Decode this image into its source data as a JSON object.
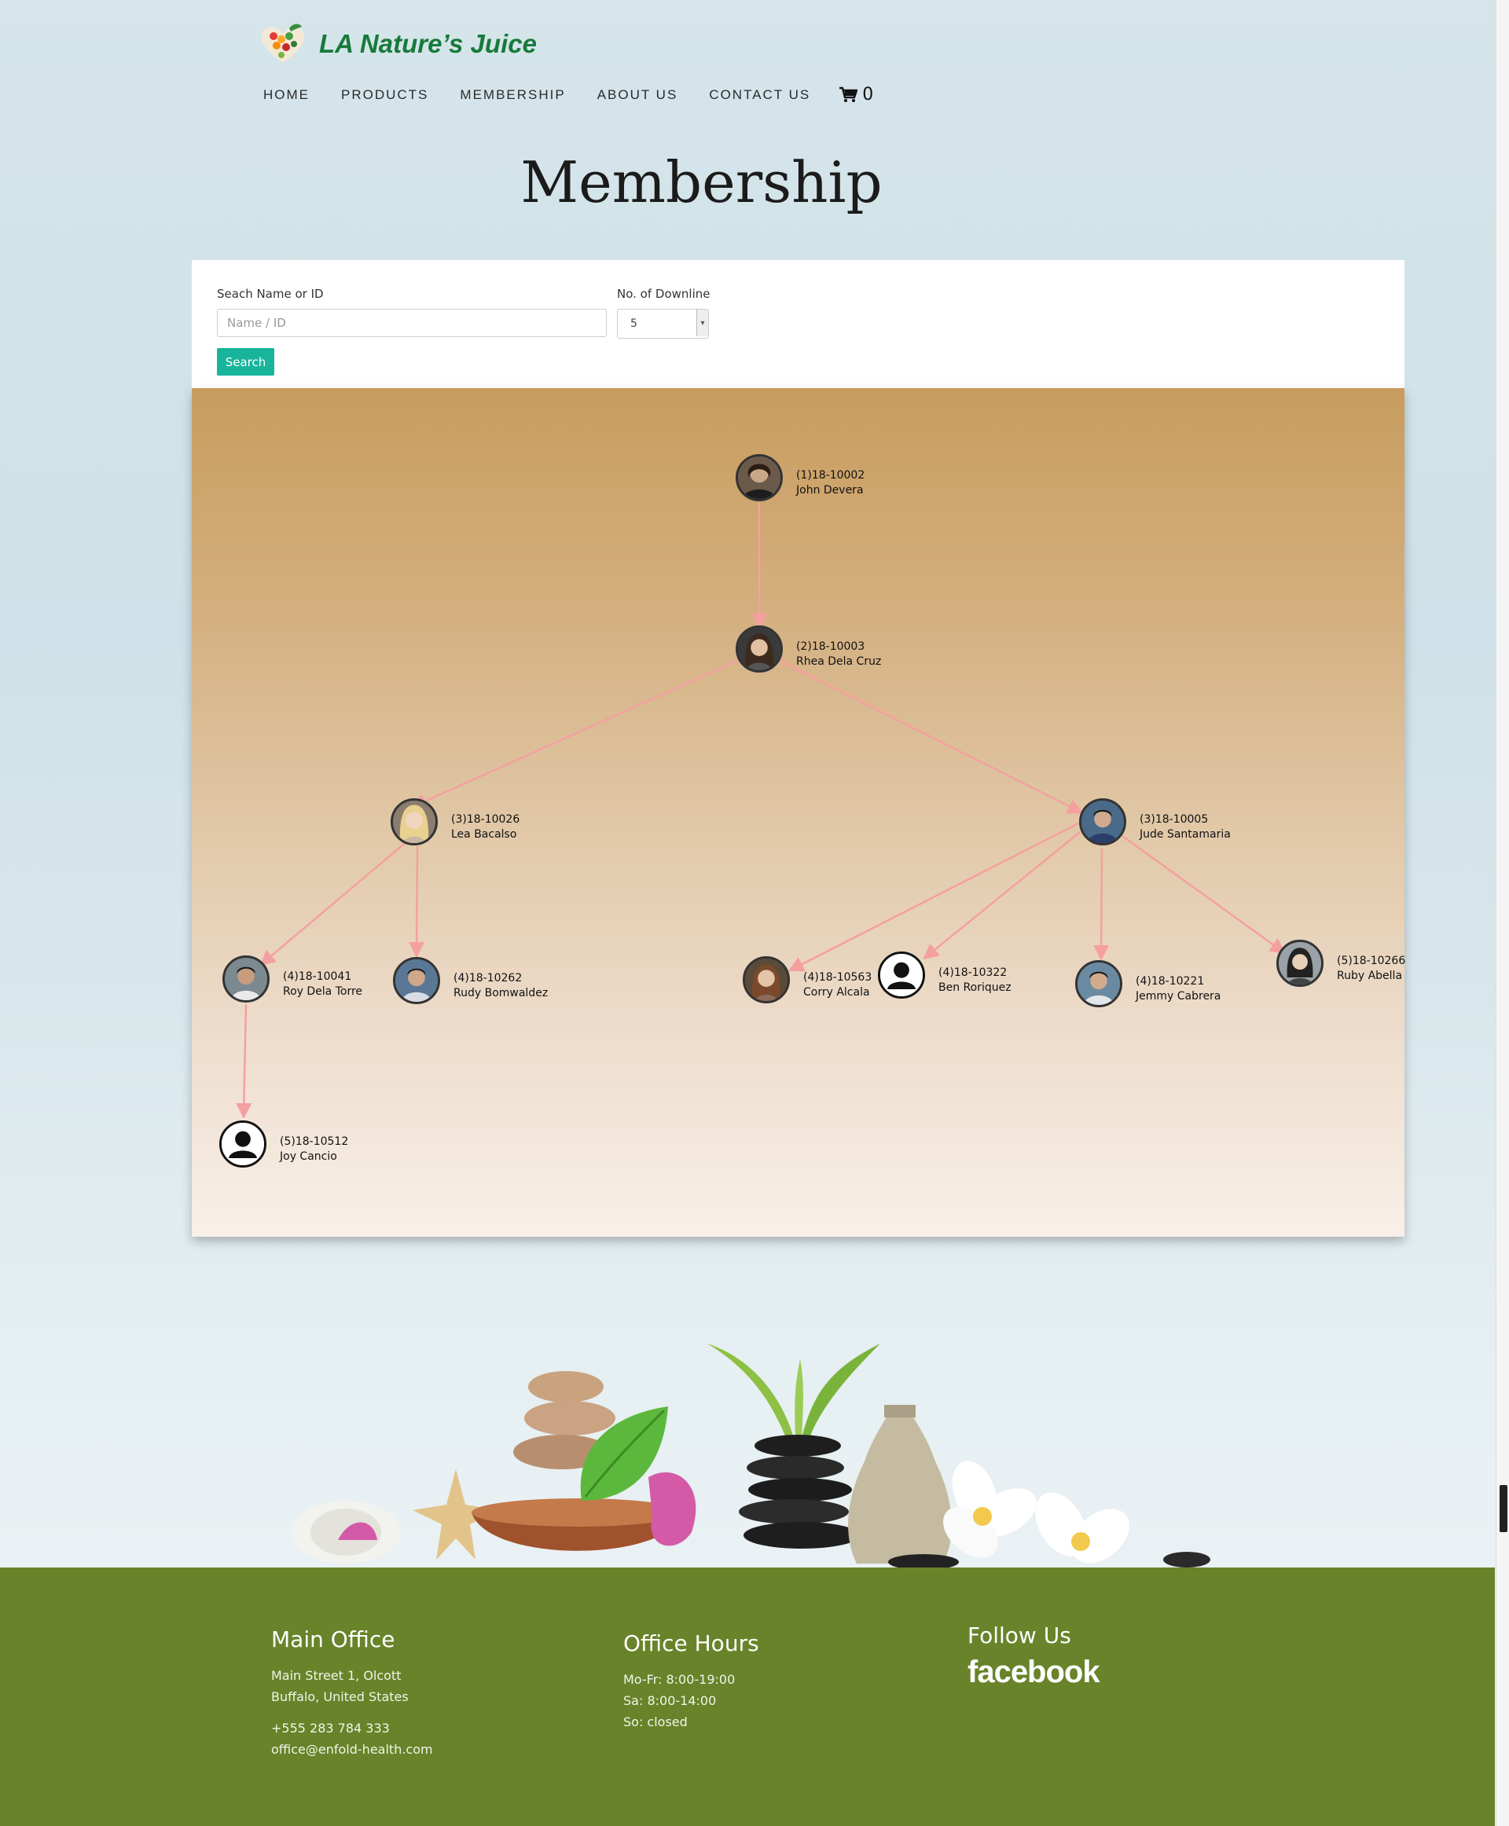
{
  "brand": {
    "name": "LA Nature’s Juice"
  },
  "nav": {
    "items": [
      "HOME",
      "PRODUCTS",
      "MEMBERSHIP",
      "ABOUT US",
      "CONTACT US"
    ],
    "cart_count": "0"
  },
  "page_title": "Membership",
  "search": {
    "name_label": "Seach Name or ID",
    "name_placeholder": "Name / ID",
    "downline_label": "No. of Downline",
    "downline_value": "5",
    "button_label": "Search"
  },
  "tree": {
    "nodes": [
      {
        "id": "(1)18-10002",
        "name": "John Devera",
        "avatar": "photo"
      },
      {
        "id": "(2)18-10003",
        "name": "Rhea Dela Cruz",
        "avatar": "photo"
      },
      {
        "id": "(3)18-10026",
        "name": "Lea Bacalso",
        "avatar": "photo"
      },
      {
        "id": "(3)18-10005",
        "name": "Jude Santamaria",
        "avatar": "photo"
      },
      {
        "id": "(4)18-10041",
        "name": "Roy Dela Torre",
        "avatar": "photo"
      },
      {
        "id": "(4)18-10262",
        "name": "Rudy Bomwaldez",
        "avatar": "photo"
      },
      {
        "id": "(4)18-10563",
        "name": "Corry Alcala",
        "avatar": "photo"
      },
      {
        "id": "(4)18-10322",
        "name": "Ben Roriquez",
        "avatar": "default-user-icon"
      },
      {
        "id": "(4)18-10221",
        "name": "Jemmy Cabrera",
        "avatar": "photo"
      },
      {
        "id": "(5)18-10266",
        "name": "Ruby Abella",
        "avatar": "photo"
      },
      {
        "id": "(5)18-10512",
        "name": "Joy Cancio",
        "avatar": "default-user-icon"
      }
    ]
  },
  "footer": {
    "main_office": {
      "heading": "Main Office",
      "address_1": "Main Street 1, Olcott",
      "address_2": "Buffalo, United States",
      "phone": "+555 283 784 333",
      "email": "office@enfold-health.com"
    },
    "office_hours": {
      "heading": "Office Hours",
      "weekdays": "Mo-Fr: 8:00-19:00",
      "saturday": "Sa: 8:00-14:00",
      "sunday": "So: closed"
    },
    "follow": {
      "heading": "Follow Us",
      "facebook": "facebook"
    }
  },
  "colors": {
    "brand_green": "#177a3a",
    "button_teal": "#18b59c",
    "footer_green": "#688329",
    "connector_pink": "#f4a0a0"
  }
}
